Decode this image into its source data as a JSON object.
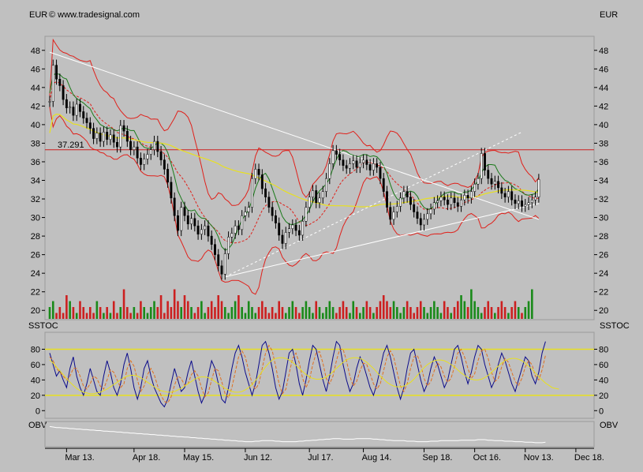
{
  "header": {
    "currency_left": "EUR",
    "currency_right": "EUR",
    "copyright": "© www.tradesignal.com"
  },
  "colors": {
    "background": "#c0c0c0",
    "price_line": "#000000",
    "bollinger": "#e0201a",
    "green_band": "#1a7a1a",
    "long_ma": "#e8e020",
    "trendline": "#ffffff",
    "resistance": "#cc2020",
    "volume_up": "#1a8a1a",
    "volume_down": "#cc2020",
    "stoch_k": "#0a0a8a",
    "stoch_d": "#e07020",
    "stoch_cycle": "#e8e020",
    "obv": "#ffffff"
  },
  "chart_data": [
    {
      "type": "line",
      "panel": "price",
      "ylabel": "EUR",
      "ylim": [
        19,
        49
      ],
      "yticks": [
        48,
        46,
        44,
        42,
        40,
        38,
        36,
        34,
        32,
        30,
        28,
        26,
        24,
        22,
        20
      ],
      "xlim": [
        0,
        160
      ],
      "xticks": [
        {
          "x": 5,
          "label": "Mar 13."
        },
        {
          "x": 25,
          "label": "Apr 18."
        },
        {
          "x": 40,
          "label": "May 15."
        },
        {
          "x": 58,
          "label": "Jun 12."
        },
        {
          "x": 77,
          "label": "Jul 17."
        },
        {
          "x": 93,
          "label": "Aug 14."
        },
        {
          "x": 111,
          "label": "Sep 18."
        },
        {
          "x": 126,
          "label": "Oct 16."
        },
        {
          "x": 141,
          "label": "Nov 13."
        },
        {
          "x": 156,
          "label": "Dec 18."
        }
      ],
      "resistance": {
        "value": 37.291,
        "label": "37.291"
      },
      "close": [
        42.5,
        46.4,
        44.9,
        44.2,
        42.7,
        41.8,
        41.9,
        41.0,
        42.2,
        41.4,
        40.7,
        40.2,
        39.6,
        38.5,
        39.1,
        38.2,
        39.2,
        38.4,
        38.9,
        38.1,
        37.6,
        39.9,
        39.3,
        38.2,
        37.3,
        37.6,
        36.4,
        35.7,
        36.3,
        36.8,
        37.3,
        38.2,
        37.1,
        36.2,
        35.2,
        33.8,
        32.1,
        30.2,
        28.6,
        31.1,
        30.2,
        29.3,
        29.9,
        29.1,
        28.2,
        28.7,
        29.1,
        28.0,
        27.1,
        26.0,
        24.8,
        23.9,
        26.1,
        27.9,
        28.3,
        29.1,
        28.7,
        30.2,
        30.6,
        31.1,
        34.2,
        35.2,
        34.6,
        33.1,
        32.2,
        31.1,
        30.2,
        29.4,
        28.1,
        27.2,
        28.4,
        28.8,
        29.2,
        28.6,
        28.1,
        29.6,
        31.1,
        32.2,
        32.9,
        31.6,
        32.1,
        32.8,
        34.2,
        35.8,
        37.2,
        36.8,
        36.2,
        35.6,
        35.3,
        35.8,
        36.1,
        35.4,
        35.9,
        36.2,
        35.7,
        35.1,
        35.8,
        35.4,
        34.2,
        32.8,
        31.1,
        29.8,
        30.6,
        31.2,
        32.1,
        32.8,
        32.2,
        31.4,
        30.6,
        29.9,
        29.2,
        29.8,
        30.4,
        30.9,
        31.6,
        31.8,
        32.2,
        31.9,
        31.4,
        32.1,
        31.6,
        31.2,
        31.9,
        32.4,
        32.1,
        32.8,
        33.6,
        34.2,
        36.9,
        35.1,
        34.2,
        33.6,
        33.9,
        33.2,
        32.6,
        32.2,
        32.8,
        31.9,
        31.5,
        31.8,
        31.2,
        31.4,
        31.6,
        31.9,
        32.2,
        34.1
      ],
      "volume": [
        2,
        3,
        1,
        2,
        1,
        4,
        3,
        2,
        1,
        3,
        2,
        1,
        2,
        1,
        3,
        2,
        1,
        2,
        1,
        3,
        1,
        2,
        5,
        2,
        1,
        2,
        1,
        3,
        2,
        1,
        2,
        3,
        2,
        4,
        1,
        3,
        2,
        5,
        3,
        2,
        4,
        3,
        2,
        1,
        2,
        3,
        1,
        2,
        3,
        2,
        4,
        3,
        2,
        1,
        2,
        3,
        4,
        2,
        1,
        3,
        2,
        1,
        2,
        3,
        2,
        1,
        2,
        1,
        3,
        2,
        1,
        2,
        3,
        2,
        1,
        2,
        3,
        2,
        1,
        3,
        2,
        1,
        2,
        3,
        2,
        1,
        2,
        3,
        2,
        1,
        3,
        2,
        1,
        2,
        3,
        2,
        1,
        2,
        3,
        4,
        3,
        2,
        3,
        2,
        1,
        2,
        3,
        2,
        1,
        2,
        3,
        2,
        1,
        2,
        3,
        2,
        1,
        3,
        2,
        1,
        2,
        3,
        4,
        3,
        2,
        5,
        3,
        2,
        1,
        2,
        3,
        2,
        1,
        2,
        3,
        2,
        1,
        2,
        3,
        2,
        1,
        2,
        3,
        5
      ]
    },
    {
      "type": "line",
      "panel": "stochastic",
      "ylabel": "SSTOC",
      "ylim": [
        -10,
        100
      ],
      "yticks": [
        80,
        60,
        40,
        20,
        0
      ],
      "levels": [
        80,
        20
      ],
      "series": [
        {
          "role": "k",
          "values": [
            75,
            60,
            45,
            52,
            40,
            30,
            55,
            70,
            45,
            30,
            20,
            35,
            55,
            40,
            25,
            20,
            45,
            65,
            50,
            30,
            20,
            35,
            60,
            75,
            55,
            30,
            15,
            30,
            55,
            65,
            45,
            30,
            20,
            10,
            5,
            15,
            35,
            55,
            40,
            25,
            30,
            50,
            65,
            45,
            25,
            10,
            20,
            45,
            65,
            55,
            35,
            15,
            10,
            30,
            55,
            75,
            85,
            70,
            50,
            35,
            20,
            35,
            60,
            85,
            90,
            75,
            55,
            30,
            15,
            25,
            50,
            75,
            80,
            60,
            35,
            20,
            40,
            65,
            85,
            80,
            60,
            40,
            25,
            45,
            70,
            90,
            85,
            60,
            40,
            25,
            35,
            55,
            70,
            60,
            45,
            30,
            20,
            35,
            55,
            75,
            85,
            70,
            50,
            30,
            15,
            30,
            55,
            75,
            80,
            60,
            40,
            25,
            35,
            55,
            70,
            60,
            45,
            30,
            40,
            60,
            80,
            85,
            70,
            50,
            35,
            50,
            70,
            85,
            80,
            60,
            45,
            30,
            40,
            60,
            75,
            65,
            50,
            35,
            25,
            40,
            55,
            70,
            65,
            45,
            35,
            50,
            75,
            90
          ]
        },
        {
          "role": "d",
          "values": [
            70,
            65,
            55,
            50,
            45,
            40,
            45,
            55,
            55,
            45,
            32,
            28,
            35,
            45,
            42,
            32,
            28,
            40,
            53,
            50,
            40,
            30,
            35,
            55,
            65,
            58,
            40,
            25,
            32,
            47,
            55,
            47,
            32,
            20,
            12,
            10,
            18,
            33,
            45,
            42,
            33,
            35,
            47,
            52,
            45,
            30,
            18,
            23,
            40,
            55,
            52,
            38,
            22,
            17,
            30,
            50,
            70,
            78,
            70,
            52,
            35,
            28,
            35,
            55,
            75,
            85,
            78,
            58,
            35,
            22,
            28,
            48,
            68,
            75,
            62,
            42,
            30,
            40,
            60,
            75,
            77,
            62,
            42,
            35,
            45,
            65,
            80,
            80,
            65,
            45,
            32,
            38,
            52,
            62,
            60,
            48,
            35,
            28,
            35,
            52,
            70,
            78,
            70,
            50,
            32,
            25,
            35,
            55,
            70,
            72,
            60,
            42,
            32,
            38,
            52,
            62,
            57,
            45,
            37,
            42,
            57,
            75,
            80,
            70,
            55,
            42,
            48,
            65,
            78,
            80,
            68,
            50,
            38,
            42,
            57,
            68,
            63,
            50,
            38,
            33,
            42,
            57,
            65,
            60,
            45,
            40,
            53,
            72
          ]
        },
        {
          "role": "cycle",
          "values": [
            66,
            62,
            57,
            52,
            47,
            42,
            37,
            33,
            29,
            26,
            24,
            23,
            22,
            22,
            23,
            24,
            26,
            28,
            31,
            34,
            37,
            40,
            43,
            45,
            46,
            46,
            45,
            43,
            40,
            37,
            34,
            31,
            28,
            26,
            25,
            24,
            24,
            25,
            27,
            29,
            32,
            35,
            38,
            41,
            43,
            44,
            44,
            43,
            41,
            38,
            35,
            32,
            29,
            27,
            25,
            24,
            24,
            25,
            27,
            30,
            34,
            39,
            45,
            51,
            57,
            62,
            66,
            68,
            69,
            69,
            68,
            66,
            63,
            59,
            55,
            51,
            47,
            44,
            42,
            41,
            41,
            42,
            44,
            47,
            51,
            55,
            59,
            63,
            66,
            68,
            69,
            69,
            68,
            66,
            63,
            59,
            55,
            50,
            45,
            41,
            37,
            34,
            32,
            31,
            31,
            32,
            34,
            37,
            41,
            46,
            51,
            56,
            60,
            63,
            65,
            66,
            66,
            65,
            63,
            60,
            57,
            53,
            49,
            46,
            43,
            41,
            40,
            40,
            41,
            43,
            46,
            50,
            54,
            58,
            62,
            65,
            67,
            68,
            68,
            67,
            65,
            62,
            58,
            54,
            49,
            44,
            40,
            36,
            33,
            30,
            29,
            28
          ]
        }
      ]
    },
    {
      "type": "line",
      "panel": "obv",
      "ylabel": "OBV",
      "series": [
        {
          "role": "obv",
          "values": [
            80,
            79,
            78,
            78,
            77,
            77,
            76,
            76,
            75,
            75,
            74,
            74,
            73,
            73,
            72,
            72,
            71,
            71,
            70,
            70,
            69,
            69,
            68,
            68,
            67,
            67,
            66,
            66,
            65,
            65,
            64,
            64,
            63,
            63,
            62,
            62,
            61,
            61,
            60,
            60,
            59,
            59,
            58,
            58,
            57,
            57,
            56,
            56,
            55,
            55,
            54,
            54,
            53,
            53,
            52,
            52,
            51,
            51,
            50,
            50,
            50,
            51,
            51,
            52,
            52,
            52,
            52,
            51,
            51,
            50,
            50,
            50,
            50,
            50,
            51,
            51,
            52,
            52,
            53,
            53,
            54,
            54,
            55,
            55,
            56,
            56,
            56,
            55,
            55,
            55,
            55,
            56,
            56,
            56,
            56,
            56,
            55,
            55,
            54,
            54,
            53,
            53,
            52,
            52,
            52,
            52,
            51,
            51,
            51,
            50,
            50,
            50,
            50,
            51,
            51,
            51,
            52,
            52,
            52,
            52,
            52,
            52,
            53,
            53,
            53,
            53,
            53,
            54,
            54,
            54,
            53,
            53,
            52,
            52,
            52,
            51,
            51,
            51,
            50,
            50,
            50,
            49,
            49,
            49,
            48,
            48,
            48,
            49
          ]
        }
      ]
    }
  ]
}
